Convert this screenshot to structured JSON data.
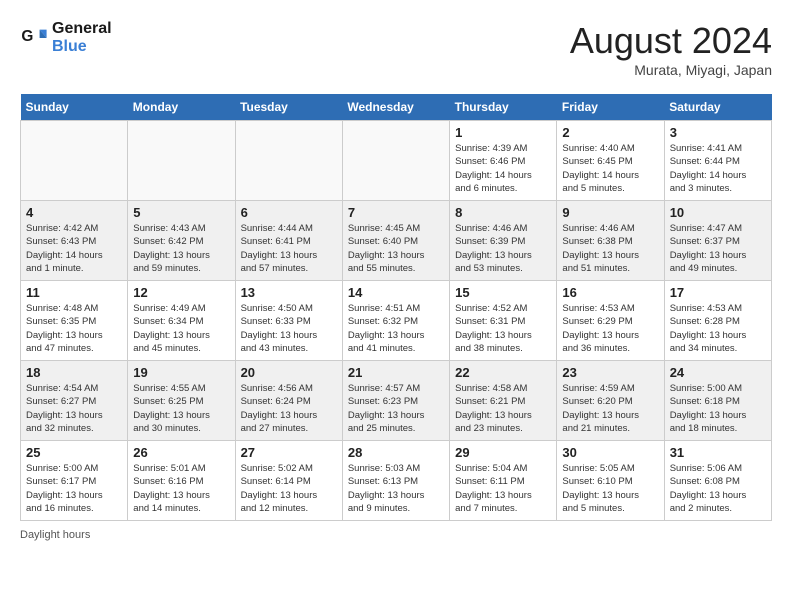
{
  "app": {
    "name": "GeneralBlue",
    "logo_text_line1": "General",
    "logo_text_line2": "Blue"
  },
  "header": {
    "month": "August 2024",
    "location": "Murata, Miyagi, Japan"
  },
  "days_of_week": [
    "Sunday",
    "Monday",
    "Tuesday",
    "Wednesday",
    "Thursday",
    "Friday",
    "Saturday"
  ],
  "weeks": [
    [
      {
        "day": "",
        "info": ""
      },
      {
        "day": "",
        "info": ""
      },
      {
        "day": "",
        "info": ""
      },
      {
        "day": "",
        "info": ""
      },
      {
        "day": "1",
        "info": "Sunrise: 4:39 AM\nSunset: 6:46 PM\nDaylight: 14 hours\nand 6 minutes."
      },
      {
        "day": "2",
        "info": "Sunrise: 4:40 AM\nSunset: 6:45 PM\nDaylight: 14 hours\nand 5 minutes."
      },
      {
        "day": "3",
        "info": "Sunrise: 4:41 AM\nSunset: 6:44 PM\nDaylight: 14 hours\nand 3 minutes."
      }
    ],
    [
      {
        "day": "4",
        "info": "Sunrise: 4:42 AM\nSunset: 6:43 PM\nDaylight: 14 hours\nand 1 minute."
      },
      {
        "day": "5",
        "info": "Sunrise: 4:43 AM\nSunset: 6:42 PM\nDaylight: 13 hours\nand 59 minutes."
      },
      {
        "day": "6",
        "info": "Sunrise: 4:44 AM\nSunset: 6:41 PM\nDaylight: 13 hours\nand 57 minutes."
      },
      {
        "day": "7",
        "info": "Sunrise: 4:45 AM\nSunset: 6:40 PM\nDaylight: 13 hours\nand 55 minutes."
      },
      {
        "day": "8",
        "info": "Sunrise: 4:46 AM\nSunset: 6:39 PM\nDaylight: 13 hours\nand 53 minutes."
      },
      {
        "day": "9",
        "info": "Sunrise: 4:46 AM\nSunset: 6:38 PM\nDaylight: 13 hours\nand 51 minutes."
      },
      {
        "day": "10",
        "info": "Sunrise: 4:47 AM\nSunset: 6:37 PM\nDaylight: 13 hours\nand 49 minutes."
      }
    ],
    [
      {
        "day": "11",
        "info": "Sunrise: 4:48 AM\nSunset: 6:35 PM\nDaylight: 13 hours\nand 47 minutes."
      },
      {
        "day": "12",
        "info": "Sunrise: 4:49 AM\nSunset: 6:34 PM\nDaylight: 13 hours\nand 45 minutes."
      },
      {
        "day": "13",
        "info": "Sunrise: 4:50 AM\nSunset: 6:33 PM\nDaylight: 13 hours\nand 43 minutes."
      },
      {
        "day": "14",
        "info": "Sunrise: 4:51 AM\nSunset: 6:32 PM\nDaylight: 13 hours\nand 41 minutes."
      },
      {
        "day": "15",
        "info": "Sunrise: 4:52 AM\nSunset: 6:31 PM\nDaylight: 13 hours\nand 38 minutes."
      },
      {
        "day": "16",
        "info": "Sunrise: 4:53 AM\nSunset: 6:29 PM\nDaylight: 13 hours\nand 36 minutes."
      },
      {
        "day": "17",
        "info": "Sunrise: 4:53 AM\nSunset: 6:28 PM\nDaylight: 13 hours\nand 34 minutes."
      }
    ],
    [
      {
        "day": "18",
        "info": "Sunrise: 4:54 AM\nSunset: 6:27 PM\nDaylight: 13 hours\nand 32 minutes."
      },
      {
        "day": "19",
        "info": "Sunrise: 4:55 AM\nSunset: 6:25 PM\nDaylight: 13 hours\nand 30 minutes."
      },
      {
        "day": "20",
        "info": "Sunrise: 4:56 AM\nSunset: 6:24 PM\nDaylight: 13 hours\nand 27 minutes."
      },
      {
        "day": "21",
        "info": "Sunrise: 4:57 AM\nSunset: 6:23 PM\nDaylight: 13 hours\nand 25 minutes."
      },
      {
        "day": "22",
        "info": "Sunrise: 4:58 AM\nSunset: 6:21 PM\nDaylight: 13 hours\nand 23 minutes."
      },
      {
        "day": "23",
        "info": "Sunrise: 4:59 AM\nSunset: 6:20 PM\nDaylight: 13 hours\nand 21 minutes."
      },
      {
        "day": "24",
        "info": "Sunrise: 5:00 AM\nSunset: 6:18 PM\nDaylight: 13 hours\nand 18 minutes."
      }
    ],
    [
      {
        "day": "25",
        "info": "Sunrise: 5:00 AM\nSunset: 6:17 PM\nDaylight: 13 hours\nand 16 minutes."
      },
      {
        "day": "26",
        "info": "Sunrise: 5:01 AM\nSunset: 6:16 PM\nDaylight: 13 hours\nand 14 minutes."
      },
      {
        "day": "27",
        "info": "Sunrise: 5:02 AM\nSunset: 6:14 PM\nDaylight: 13 hours\nand 12 minutes."
      },
      {
        "day": "28",
        "info": "Sunrise: 5:03 AM\nSunset: 6:13 PM\nDaylight: 13 hours\nand 9 minutes."
      },
      {
        "day": "29",
        "info": "Sunrise: 5:04 AM\nSunset: 6:11 PM\nDaylight: 13 hours\nand 7 minutes."
      },
      {
        "day": "30",
        "info": "Sunrise: 5:05 AM\nSunset: 6:10 PM\nDaylight: 13 hours\nand 5 minutes."
      },
      {
        "day": "31",
        "info": "Sunrise: 5:06 AM\nSunset: 6:08 PM\nDaylight: 13 hours\nand 2 minutes."
      }
    ]
  ],
  "footer": {
    "daylight_label": "Daylight hours"
  }
}
